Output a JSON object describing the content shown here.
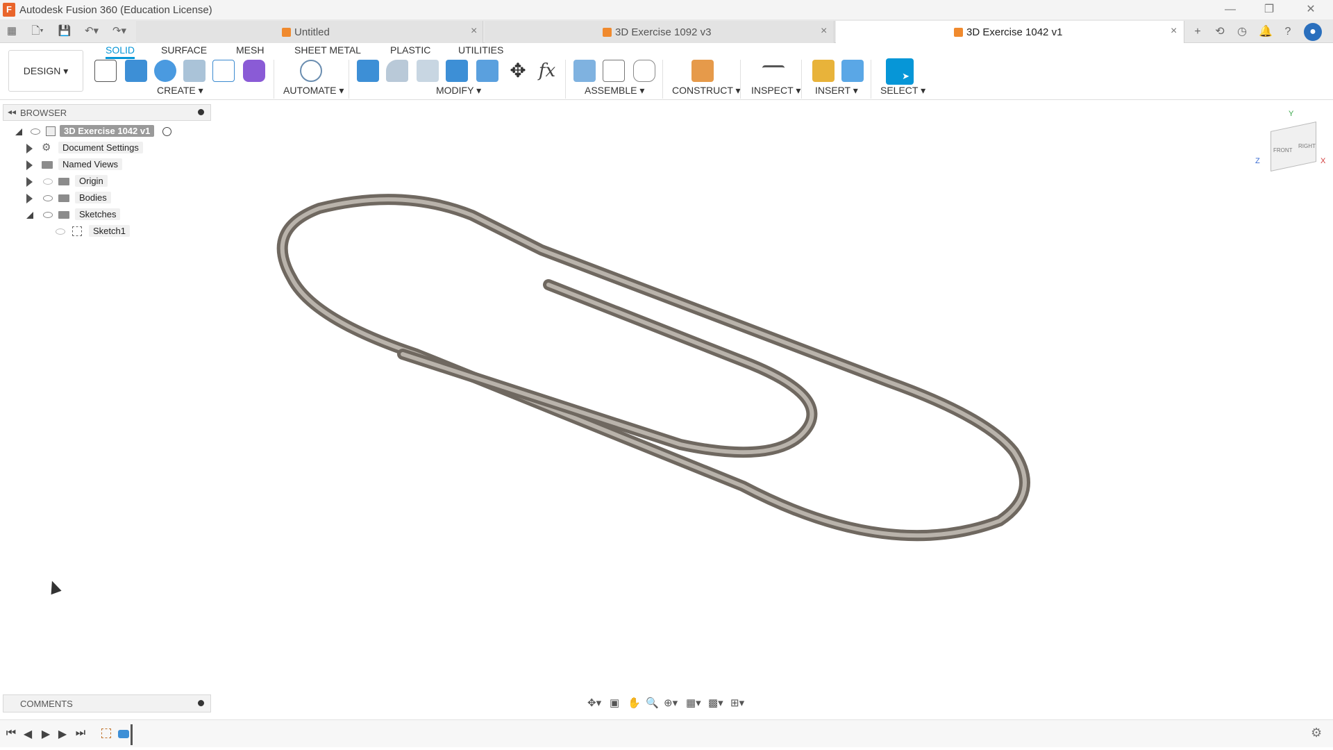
{
  "titlebar": {
    "title": "Autodesk Fusion 360 (Education License)",
    "logo": "F"
  },
  "tabs": [
    {
      "label": "Untitled"
    },
    {
      "label": "3D Exercise 1092 v3"
    },
    {
      "label": "3D Exercise 1042 v1"
    }
  ],
  "ribbon": {
    "tabs": [
      "SOLID",
      "SURFACE",
      "MESH",
      "SHEET METAL",
      "PLASTIC",
      "UTILITIES"
    ],
    "workspace": "DESIGN ▾",
    "groups": [
      "CREATE ▾",
      "AUTOMATE ▾",
      "MODIFY ▾",
      "ASSEMBLE ▾",
      "CONSTRUCT ▾",
      "INSPECT ▾",
      "INSERT ▾",
      "SELECT ▾"
    ]
  },
  "browser": {
    "title": "BROWSER",
    "root": "3D Exercise 1042 v1",
    "items": [
      "Document Settings",
      "Named Views",
      "Origin",
      "Bodies",
      "Sketches",
      "Sketch1"
    ]
  },
  "comments": {
    "title": "COMMENTS"
  },
  "viewcube": {
    "front": "FRONT",
    "right": "RIGHT",
    "axis_x": "X",
    "axis_y": "Y",
    "axis_z": "Z"
  },
  "colors": {
    "accent": "#0696d7",
    "brand": "#e9652b"
  },
  "icons": {
    "select_tool": "select-arrow-icon",
    "settings": "gear-icon"
  }
}
